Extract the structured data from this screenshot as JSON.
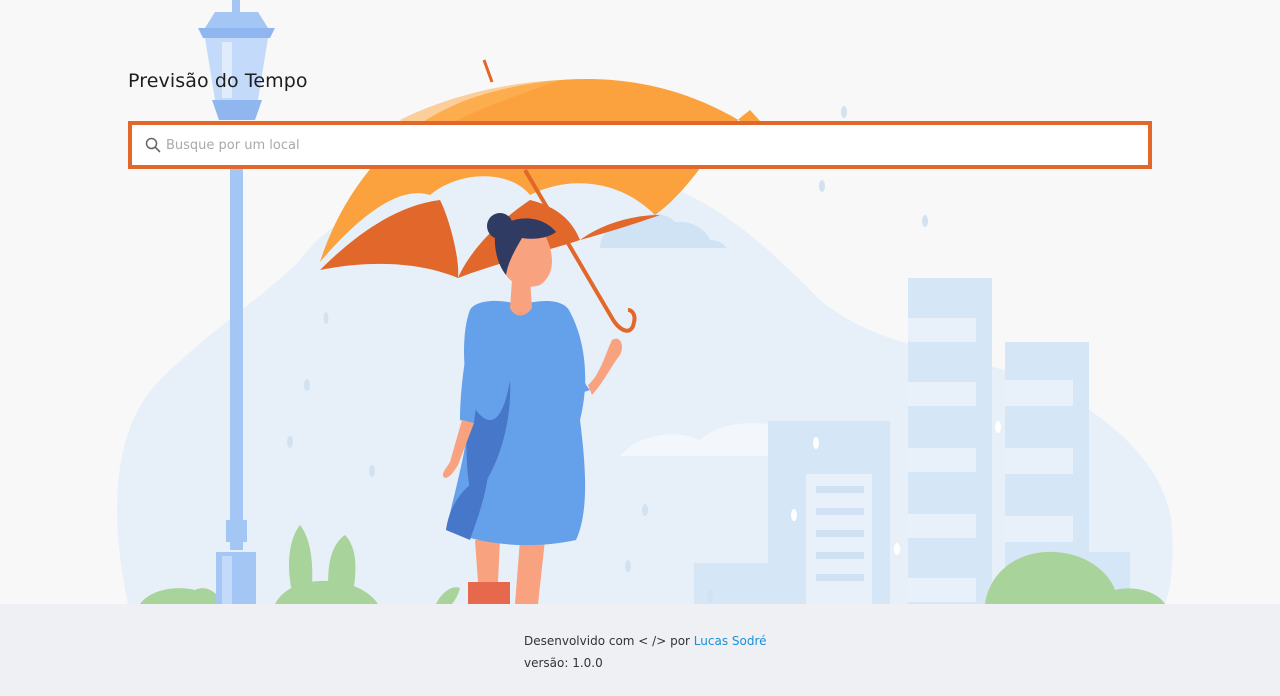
{
  "header": {
    "title": "Previsão do Tempo"
  },
  "search": {
    "placeholder": "Busque por um local",
    "value": ""
  },
  "footer": {
    "developed_prefix": "Desenvolvido com < /> por",
    "author_link": "Lucas Sodré",
    "version_label": "versão: 1.0.0"
  },
  "theme": {
    "accent": "#e2672a",
    "link": "#1b8fd6",
    "footer_bg": "#eff0f4"
  },
  "icons": {
    "search": "magnifier"
  }
}
